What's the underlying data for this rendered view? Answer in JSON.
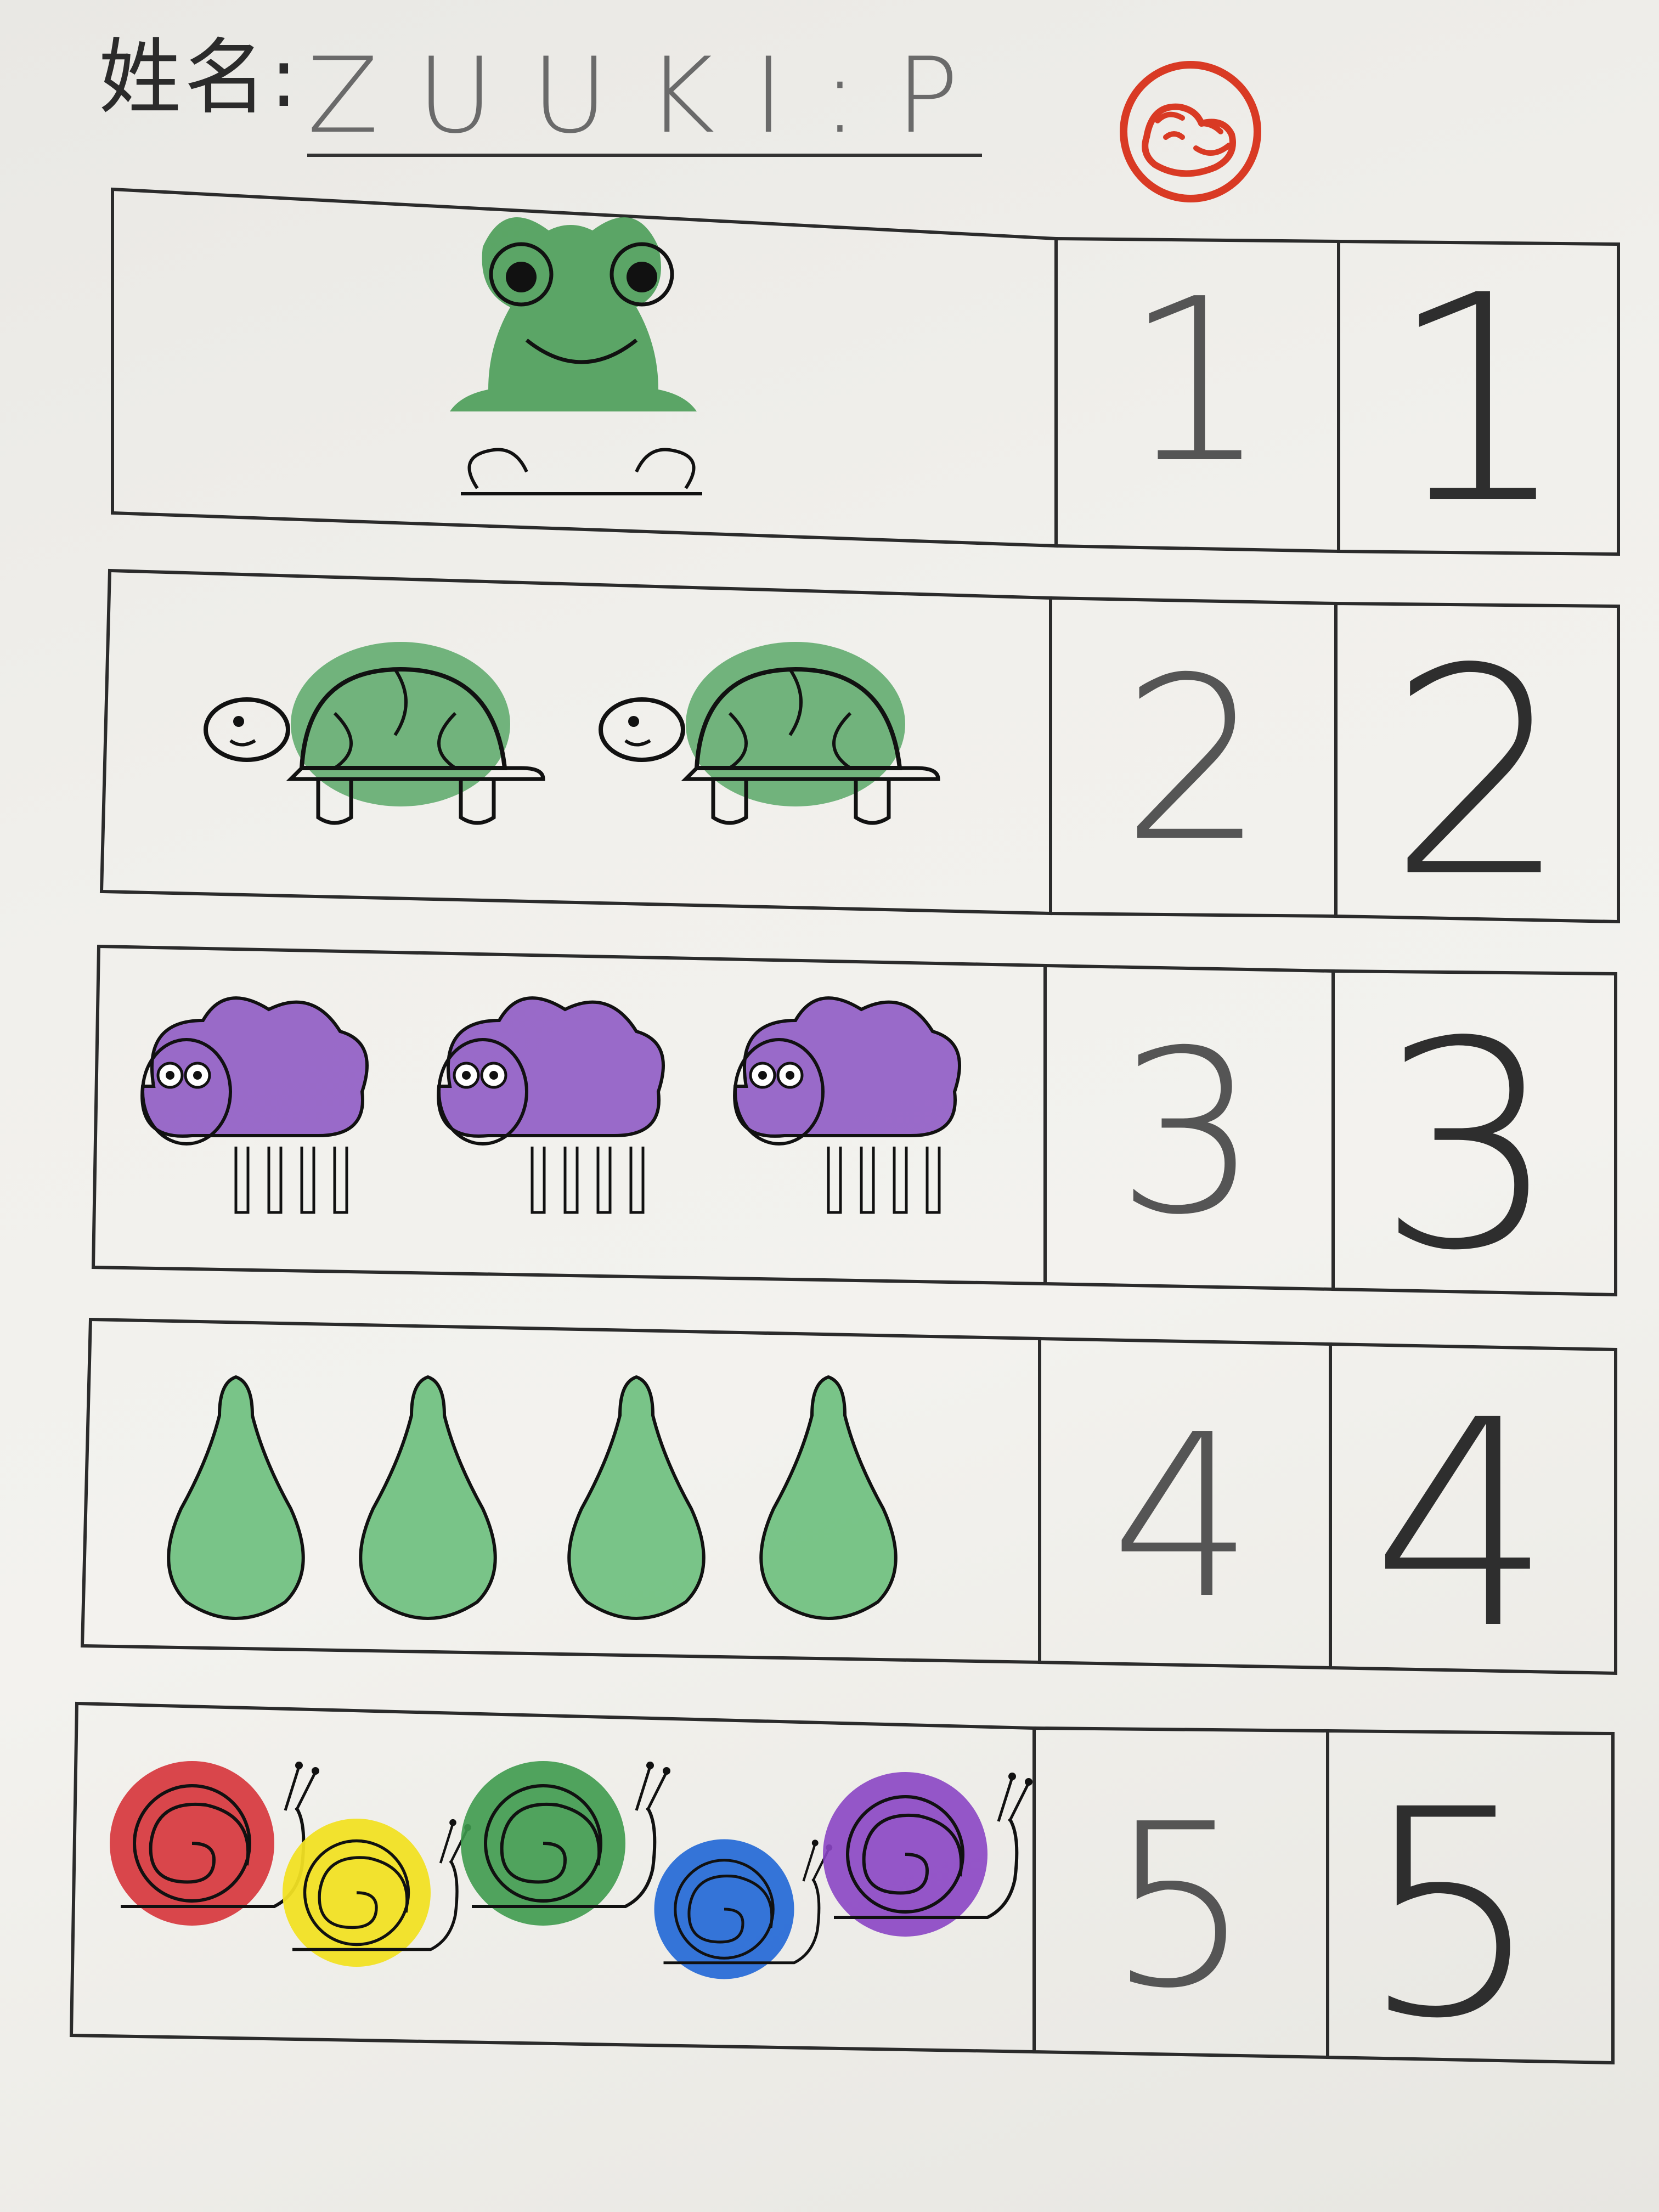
{
  "header": {
    "name_label": "姓名:",
    "name_value": "ZUUKI:P"
  },
  "stamp": {
    "icon": "praise-hand-stamp-icon",
    "color": "#d93a24"
  },
  "rows": [
    {
      "animal": "frog",
      "count": 1,
      "traced": "1",
      "written": "1",
      "colors": [
        "#4e9e5a"
      ]
    },
    {
      "animal": "turtle",
      "count": 2,
      "traced": "2",
      "written": "2",
      "colors": [
        "#5aa868"
      ]
    },
    {
      "animal": "sheep",
      "count": 3,
      "traced": "3",
      "written": "3",
      "colors": [
        "#8a52c2"
      ]
    },
    {
      "animal": "pear",
      "count": 4,
      "traced": "4",
      "written": "4",
      "colors": [
        "#6bbf7c"
      ]
    },
    {
      "animal": "snail",
      "count": 5,
      "traced": "5",
      "written": "5",
      "colors": [
        "#d6333a",
        "#f1e024",
        "#3e9a4e",
        "#1f66d6",
        "#8a45c4"
      ]
    }
  ]
}
